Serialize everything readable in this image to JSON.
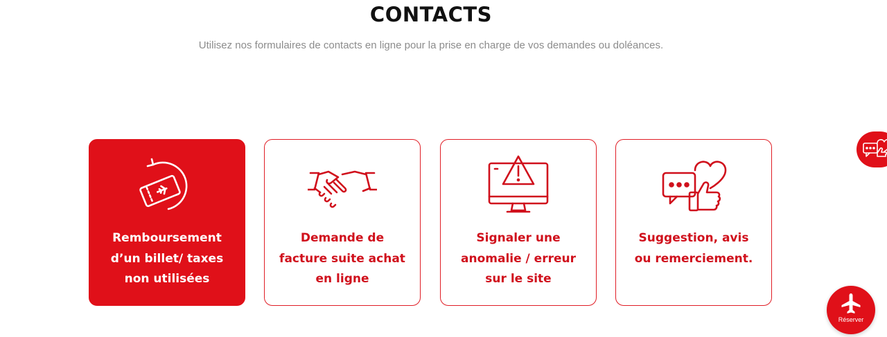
{
  "header": {
    "title": "CONTACTS",
    "subtitle": "Utilisez nos formulaires de contacts en ligne pour la prise en charge de vos demandes ou doléances."
  },
  "cards": [
    {
      "line1": "Remboursement",
      "line2": "d’un billet/ taxes",
      "line3": "non utilisées",
      "icon": "ticket-refund-icon",
      "active": true
    },
    {
      "line1": "Demande de",
      "line2": "facture suite achat",
      "line3": "en ligne",
      "icon": "handshake-icon",
      "active": false
    },
    {
      "line1": "Signaler une",
      "line2": "anomalie / erreur",
      "line3": "sur le site",
      "icon": "monitor-warning-icon",
      "active": false
    },
    {
      "line1": "Suggestion, avis",
      "line2": "ou remerciement.",
      "line3": "",
      "icon": "feedback-heart-icon",
      "active": false
    }
  ],
  "floating": {
    "reserve_label": "Réserver",
    "side_tab_icon": "chat-feedback-icon",
    "reserve_icon": "airplane-icon"
  },
  "colors": {
    "brand_red": "#e01019",
    "text_dark": "#111111",
    "subtitle_gray": "#8c8c8c"
  }
}
